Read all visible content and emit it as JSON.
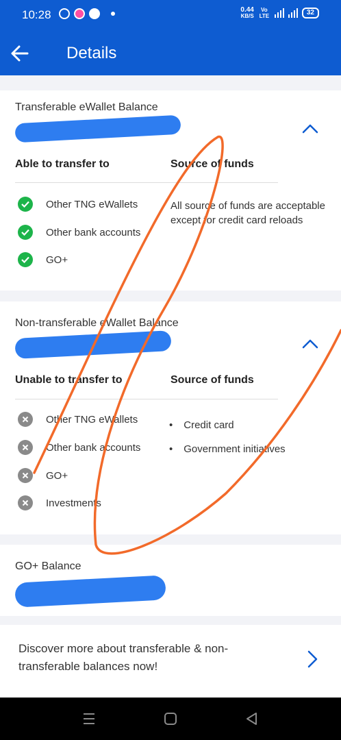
{
  "status_bar": {
    "time": "10:28",
    "net_speed": "0.44",
    "net_unit": "KB/S",
    "volte": "Vo LTE",
    "battery": "32",
    "icons": [
      "whatsapp-icon",
      "notification-app-icon",
      "messenger-icon",
      "dot-icon",
      "volte-icon",
      "4g-signal-icon",
      "signal-icon",
      "battery-icon"
    ]
  },
  "app_bar": {
    "title": "Details",
    "back_icon": "arrow-left-icon"
  },
  "transferable": {
    "label": "Transferable eWallet Balance",
    "col_left": "Able to transfer to",
    "col_right": "Source of funds",
    "items": [
      "Other TNG eWallets",
      "Other bank accounts",
      "GO+"
    ],
    "source_text": "All source of funds are acceptable except for credit card reloads",
    "item_icon": "check-circle-icon",
    "collapse_icon": "chevron-up-icon"
  },
  "non_transferable": {
    "label": "Non-transferable eWallet Balance",
    "col_left": "Unable to transfer to",
    "col_right": "Source of funds",
    "items": [
      "Other TNG eWallets",
      "Other bank accounts",
      "GO+",
      "Investments"
    ],
    "sources": [
      "Credit card",
      "Government initiatives"
    ],
    "item_icon": "x-circle-icon",
    "collapse_icon": "chevron-up-icon"
  },
  "go_plus": {
    "label": "GO+ Balance"
  },
  "promo": {
    "text": "Discover more about transferable & non-transferable balances now!",
    "arrow_icon": "chevron-right-icon"
  },
  "nav_bar": {
    "icons": [
      "recents-icon",
      "home-icon",
      "back-icon"
    ]
  },
  "colors": {
    "brand_blue": "#0e5cd1",
    "scribble_blue": "#2e7df0",
    "check_green": "#1db44a",
    "x_gray": "#8a8a8a",
    "annotation_orange": "#f26a2a"
  }
}
